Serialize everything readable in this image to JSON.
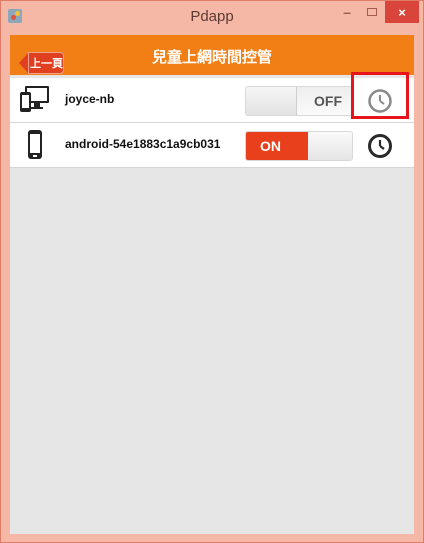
{
  "window": {
    "title": "Pdapp",
    "icon": "app-icon",
    "controls": {
      "minimize": "–",
      "maximize": "□",
      "close": "×"
    }
  },
  "appbar": {
    "back_label": "上一頁",
    "title": "兒童上網時間控管"
  },
  "devices": [
    {
      "icon": "desktop-mobile-icon",
      "name": "joyce-nb",
      "toggle_label": "OFF",
      "toggle_state": "off",
      "schedule_icon": "clock-icon",
      "highlighted": true
    },
    {
      "icon": "smartphone-icon",
      "name": "android-54e1883c1a9cb031",
      "toggle_label": "ON",
      "toggle_state": "on",
      "schedule_icon": "clock-icon",
      "highlighted": false
    }
  ],
  "colors": {
    "titlebar": "#f6b8a6",
    "appbar": "#f27f16",
    "back_button": "#e0401f",
    "toggle_on": "#e8401c",
    "highlight": "#e8141c",
    "content_bg": "#e6e6e6"
  }
}
